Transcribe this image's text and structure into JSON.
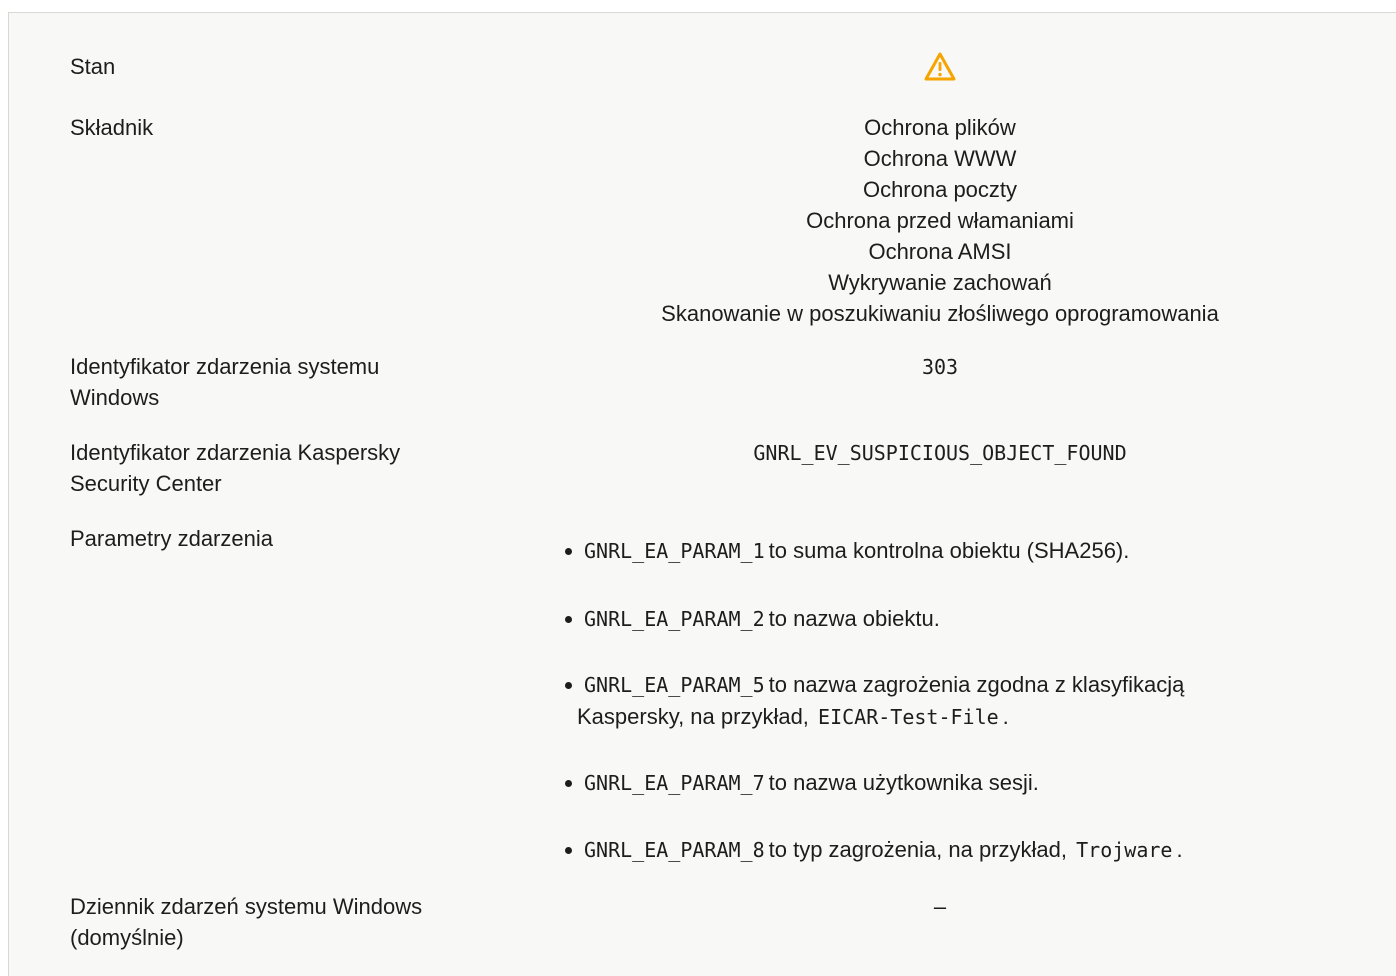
{
  "rows": {
    "stan": {
      "label": "Stan",
      "icon": "warning-triangle-icon",
      "icon_color": "#f5a400"
    },
    "skladnik": {
      "label": "Składnik",
      "values": [
        "Ochrona plików",
        "Ochrona WWW",
        "Ochrona poczty",
        "Ochrona przed włamaniami",
        "Ochrona AMSI",
        "Wykrywanie zachowań",
        "Skanowanie w poszukiwaniu złośliwego oprogramowania"
      ]
    },
    "windows_id": {
      "label_1": "Identyfikator zdarzenia systemu",
      "label_2": "Windows",
      "value": "303"
    },
    "ksc_id": {
      "label_1": "Identyfikator zdarzenia Kaspersky",
      "label_2": "Security Center",
      "value": "GNRL_EV_SUSPICIOUS_OBJECT_FOUND"
    },
    "params": {
      "label": "Parametry zdarzenia",
      "items": [
        {
          "code": "GNRL_EA_PARAM_1",
          "text": "to suma kontrolna obiektu (SHA256)."
        },
        {
          "code": "GNRL_EA_PARAM_2",
          "text": "to nazwa obiektu."
        },
        {
          "code": "GNRL_EA_PARAM_5",
          "text": "to nazwa zagrożenia zgodna z klasyfikacją",
          "text_2": "Kaspersky, na przykład,",
          "example": "EICAR-Test-File",
          "end": "."
        },
        {
          "code": "GNRL_EA_PARAM_7",
          "text": "to nazwa użytkownika sesji."
        },
        {
          "code": "GNRL_EA_PARAM_8",
          "text": "to typ zagrożenia, na przykład,",
          "example": "Trojware",
          "end": "."
        }
      ]
    },
    "dziennik": {
      "label_1": "Dziennik zdarzeń systemu Windows",
      "label_2": "(domyślnie)",
      "value": "–"
    }
  }
}
